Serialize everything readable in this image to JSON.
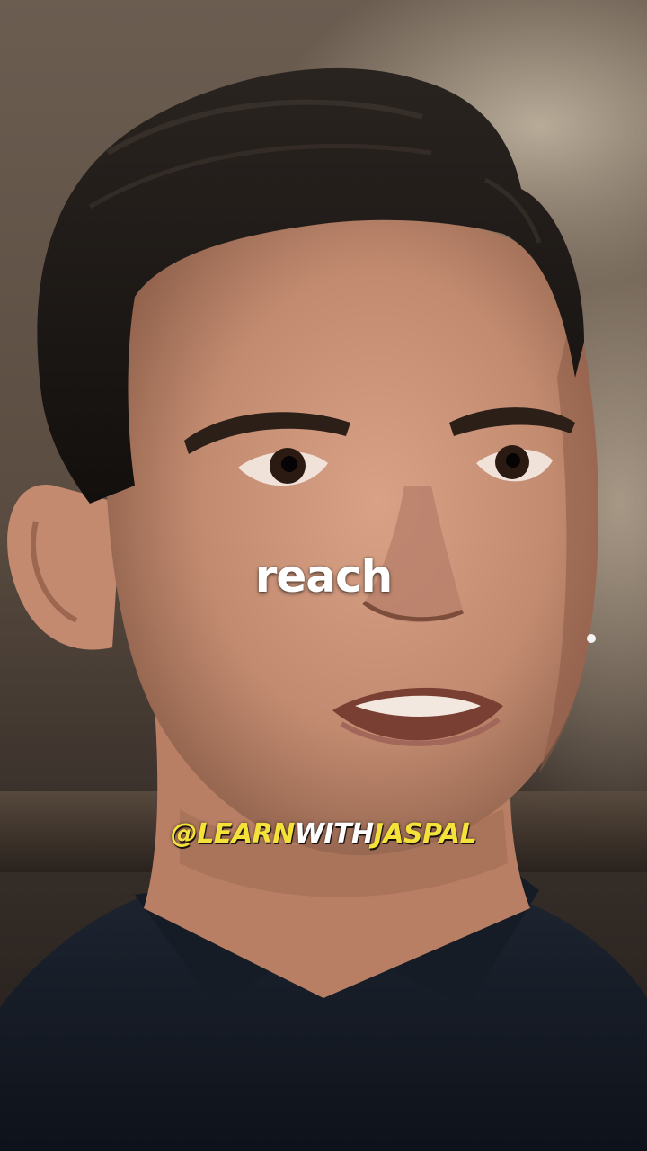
{
  "caption": {
    "word": "reach"
  },
  "watermark": {
    "part1": "@LEARN",
    "part2": "WITH",
    "part3": "JASPAL"
  }
}
